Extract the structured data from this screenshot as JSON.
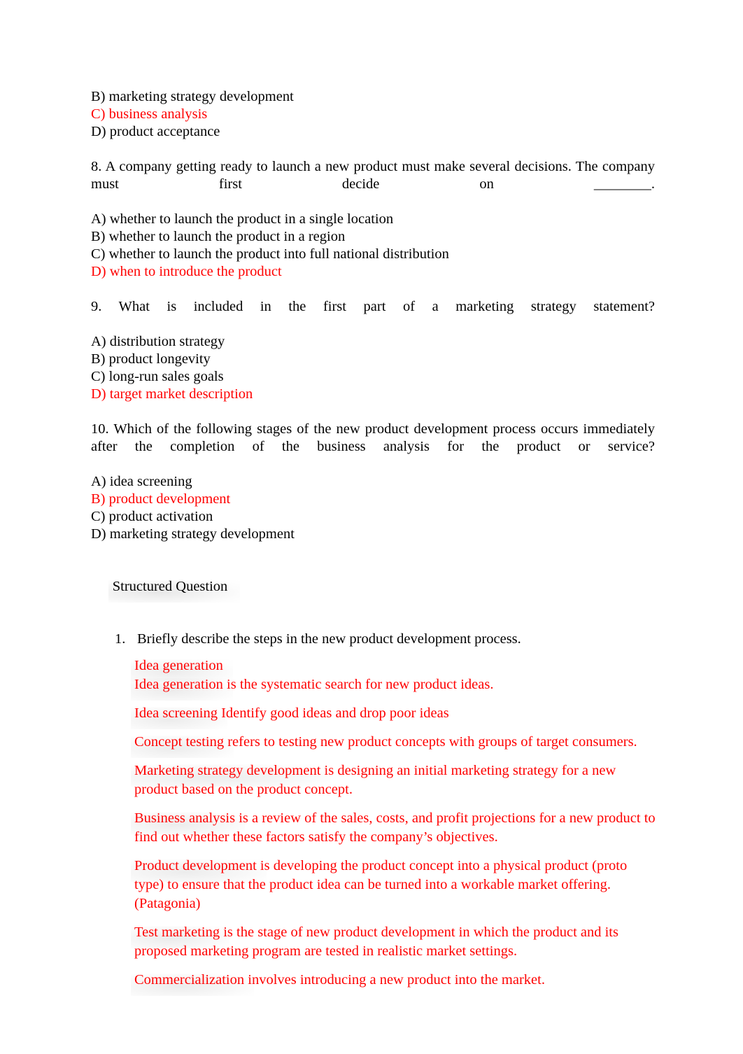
{
  "document": {
    "page_background": "#ffffff",
    "answer_color": "#ff0000",
    "body_color": "#000000"
  },
  "questions": [
    {
      "id": "q7-tail",
      "options": [
        {
          "label": "B) marketing strategy development",
          "is_answer": false
        },
        {
          "label": "C) business analysis",
          "is_answer": true
        },
        {
          "label": "D) product acceptance",
          "is_answer": false
        }
      ]
    },
    {
      "id": "q8",
      "stem": "8. A company getting ready to launch a new product must make several decisions. The company must first decide on ________.",
      "options": [
        {
          "label": "A) whether to launch the product in a single location",
          "is_answer": false
        },
        {
          "label": "B) whether to launch the product in a region",
          "is_answer": false
        },
        {
          "label": "C) whether to launch the product into full national distribution",
          "is_answer": false
        },
        {
          "label": "D) when to introduce the product",
          "is_answer": true
        }
      ]
    },
    {
      "id": "q9",
      "stem": "9. What is included in the first part of a marketing strategy statement?",
      "options": [
        {
          "label": "A) distribution strategy",
          "is_answer": false
        },
        {
          "label": "B) product longevity",
          "is_answer": false
        },
        {
          "label": "C) long-run sales goals",
          "is_answer": false
        },
        {
          "label": "D) target market description",
          "is_answer": true
        }
      ]
    },
    {
      "id": "q10",
      "stem": "10. Which of the following stages of the new product development process occurs immediately after the completion of the business analysis for the product or service?",
      "options": [
        {
          "label": "A) idea screening",
          "is_answer": false
        },
        {
          "label": "B) product development",
          "is_answer": true
        },
        {
          "label": "C) product activation",
          "is_answer": false
        },
        {
          "label": "D) marketing strategy development",
          "is_answer": false
        }
      ]
    }
  ],
  "structured_section": {
    "heading": "Structured Question",
    "item_number": "1.",
    "item_text": "Briefly describe the steps in the new product development process.",
    "answer_paragraphs": [
      {
        "term": "Idea generation",
        "rest": ""
      },
      {
        "term": "Idea generation",
        "rest": "   is the systematic search for new product ideas."
      },
      {
        "term": "Idea screening",
        "rest": "   Identify good ideas and drop poor ideas"
      },
      {
        "term": "Concept testing",
        "rest": "   refers to testing new product concepts with groups of target consumers."
      },
      {
        "term": "Marketing strategy development",
        "rest": "    is designing an initial marketing strategy for a new product based on the product concept."
      },
      {
        "term": "Business analysis",
        "rest": "  is a review of the sales, costs, and profit projections for a new product to find out whether these factors satisfy the company’s objectives."
      },
      {
        "term": "Product development",
        "rest": "   is developing the product concept into a physical product (proto type) to ensure that the product idea can be turned into a workable market offering. (Patagonia)"
      },
      {
        "term": "Test marketing",
        "rest": "   is the stage of new product development in which the product and its proposed marketing program are tested in realistic market settings."
      },
      {
        "term": "Commercialization",
        "rest": "   involves introducing a new product into the market."
      }
    ]
  }
}
